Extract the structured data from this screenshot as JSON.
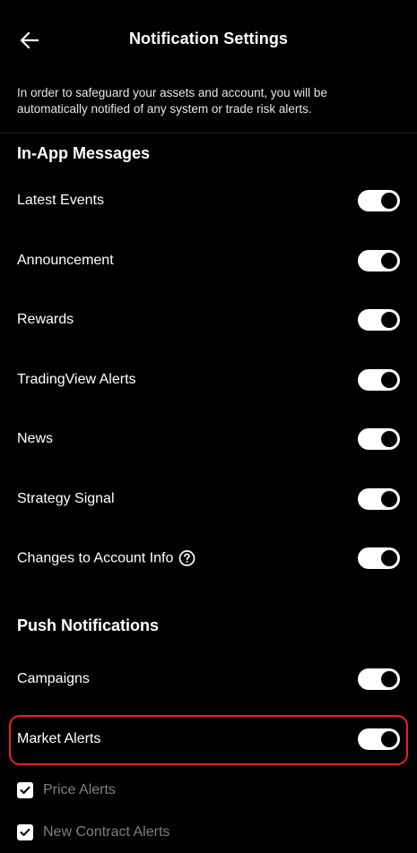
{
  "header": {
    "title": "Notification Settings",
    "back_icon": "arrow-left-icon"
  },
  "notice": "In order to safeguard your assets and account, you will be automatically notified of any system or trade risk alerts.",
  "in_app": {
    "title": "In-App Messages",
    "items": [
      {
        "label": "Latest Events",
        "enabled": true
      },
      {
        "label": "Announcement",
        "enabled": true
      },
      {
        "label": "Rewards",
        "enabled": true
      },
      {
        "label": "TradingView Alerts",
        "enabled": true
      },
      {
        "label": "News",
        "enabled": true
      },
      {
        "label": "Strategy Signal",
        "enabled": true
      },
      {
        "label": "Changes to Account Info",
        "enabled": true,
        "help_icon": "question-circle-icon"
      }
    ]
  },
  "push": {
    "title": "Push Notifications",
    "items": [
      {
        "label": "Campaigns",
        "enabled": true
      },
      {
        "label": "Market Alerts",
        "enabled": true,
        "highlighted": true
      }
    ],
    "sub_options": [
      {
        "label": "Price Alerts",
        "checked": true
      },
      {
        "label": "New Contract Alerts",
        "checked": true
      }
    ]
  },
  "colors": {
    "background": "#000000",
    "text": "#ffffff",
    "muted_text": "#7f7f7f",
    "toggle_on": "#ffffff",
    "highlight": "#e8241a"
  }
}
